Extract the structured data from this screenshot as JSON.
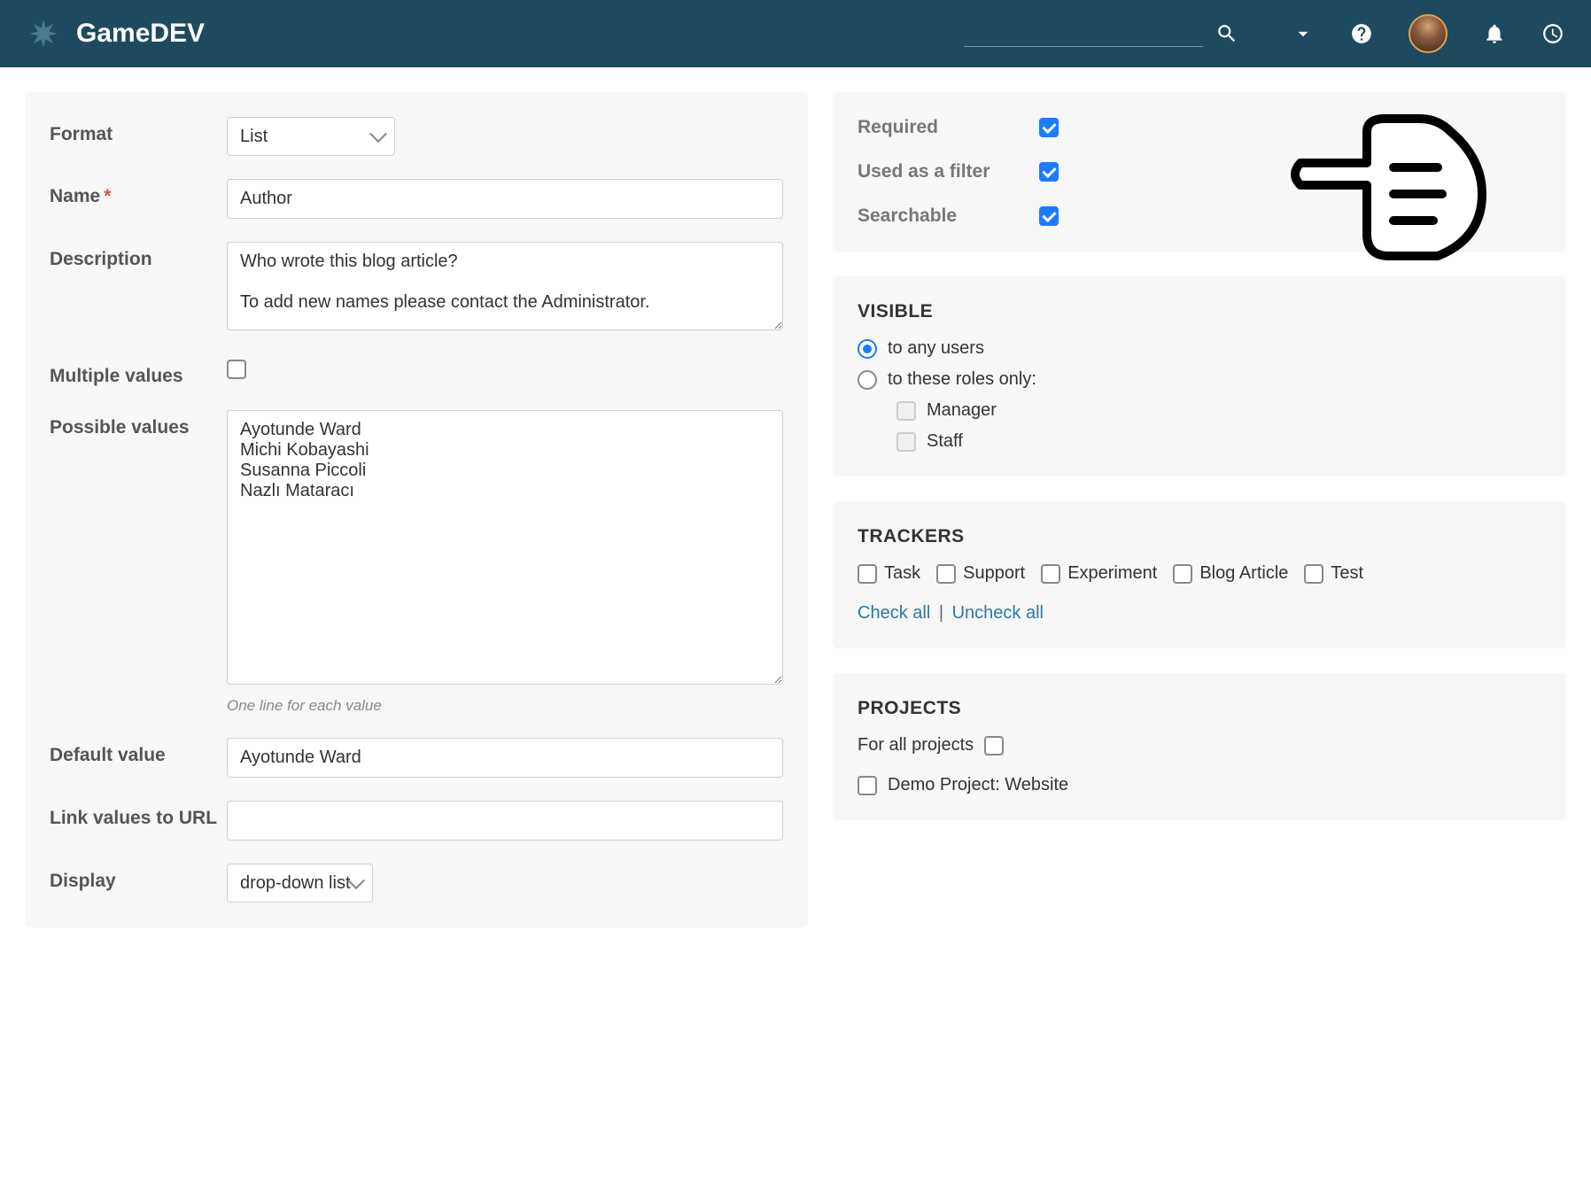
{
  "header": {
    "brand": "GameDEV"
  },
  "form": {
    "format": {
      "label": "Format",
      "value": "List"
    },
    "name": {
      "label": "Name",
      "value": "Author",
      "required": true
    },
    "description": {
      "label": "Description",
      "value": "Who wrote this blog article?\n\nTo add new names please contact the Administrator."
    },
    "multiple_values": {
      "label": "Multiple values",
      "checked": false
    },
    "possible_values": {
      "label": "Possible values",
      "value": "Ayotunde Ward\nMichi Kobayashi\nSusanna Piccoli\nNazlı Mataracı",
      "hint": "One line for each value"
    },
    "default_value": {
      "label": "Default value",
      "value": "Ayotunde Ward"
    },
    "link_values": {
      "label": "Link values to URL",
      "value": ""
    },
    "display": {
      "label": "Display",
      "value": "drop-down list"
    }
  },
  "toggles": {
    "required": {
      "label": "Required",
      "checked": true
    },
    "used_as_filter": {
      "label": "Used as a filter",
      "checked": true
    },
    "searchable": {
      "label": "Searchable",
      "checked": true
    }
  },
  "visible": {
    "title": "VISIBLE",
    "options": {
      "any_users": {
        "label": "to any users",
        "selected": true
      },
      "these_roles": {
        "label": "to these roles only:",
        "selected": false
      }
    },
    "roles": [
      {
        "label": "Manager",
        "checked": false
      },
      {
        "label": "Staff",
        "checked": false
      }
    ]
  },
  "trackers": {
    "title": "TRACKERS",
    "items": [
      {
        "label": "Task",
        "checked": false
      },
      {
        "label": "Support",
        "checked": false
      },
      {
        "label": "Experiment",
        "checked": false
      },
      {
        "label": "Blog Article",
        "checked": false
      },
      {
        "label": "Test",
        "checked": false
      }
    ],
    "check_all": "Check all",
    "uncheck_all": "Uncheck all"
  },
  "projects": {
    "title": "PROJECTS",
    "for_all": {
      "label": "For all projects",
      "checked": false
    },
    "items": [
      {
        "label": "Demo Project: Website",
        "checked": false
      }
    ]
  }
}
